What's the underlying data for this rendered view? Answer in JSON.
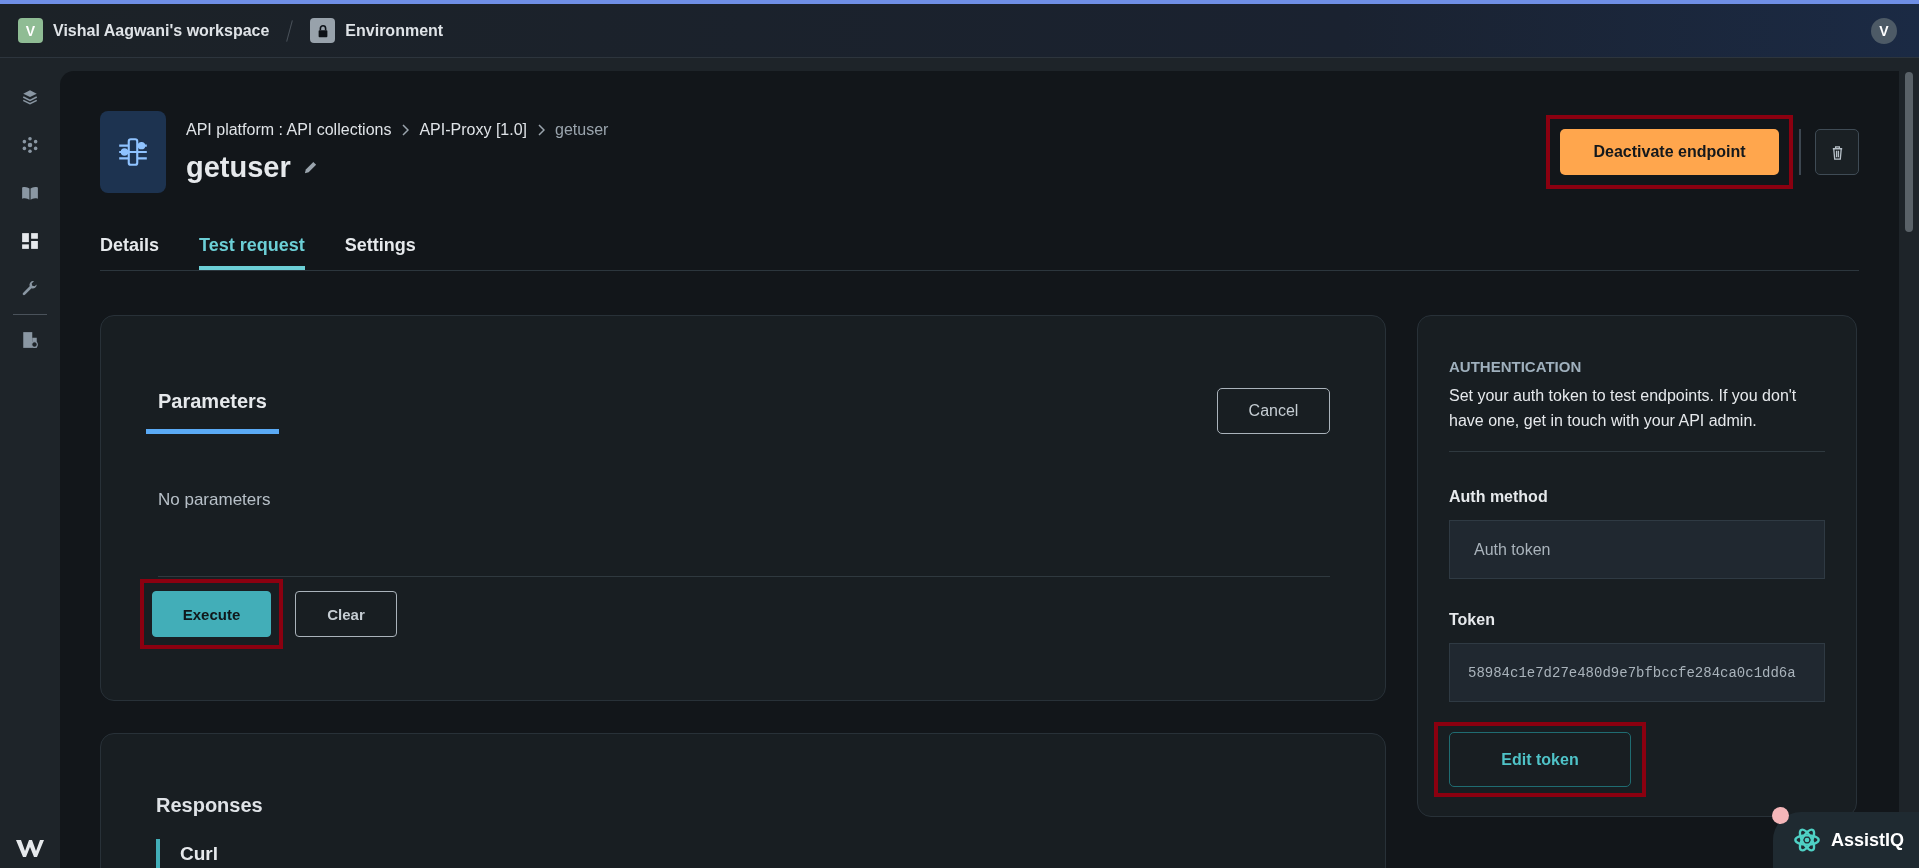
{
  "top_bar": {
    "workspace_initial": "V",
    "workspace": "Vishal Aagwani's workspace",
    "environment": "Environment",
    "user_initial": "V"
  },
  "sidebar": {
    "items": [
      {
        "kind": "layers"
      },
      {
        "kind": "cluster"
      },
      {
        "kind": "book"
      },
      {
        "kind": "grid"
      },
      {
        "kind": "wrench"
      },
      {
        "kind": "divider"
      },
      {
        "kind": "building"
      }
    ]
  },
  "header": {
    "breadcrumb": [
      "API platform : API collections",
      "API-Proxy [1.0]",
      "getuser"
    ],
    "title": "getuser",
    "deactivate_button": {
      "label": "Deactivate endpoint",
      "highlighted": true
    }
  },
  "tabs": [
    {
      "label": "Details",
      "selected": false
    },
    {
      "label": "Test request",
      "selected": true
    },
    {
      "label": "Settings",
      "selected": false
    }
  ],
  "parameters": {
    "tab": "Parameters",
    "cancel": "Cancel",
    "empty": "No parameters",
    "buttons": [
      {
        "kind": "primary",
        "label": "Execute",
        "highlighted": true
      },
      {
        "kind": "outline",
        "label": "Clear",
        "highlighted": false
      }
    ]
  },
  "authentication": {
    "heading": "AUTHENTICATION",
    "description": "Set your auth token to test endpoints. If you don't have one, get in touch with your API admin.",
    "method_label": "Auth method",
    "method_value": "Auth token",
    "token_label": "Token",
    "token_value": "58984c1e7d27e480d9e7bfbccfe284ca0c1dd6a",
    "edit_button": {
      "label": "Edit token",
      "highlighted": true
    }
  },
  "responses": {
    "heading": "Responses",
    "items": [
      {
        "label": "Curl",
        "selected": true
      }
    ]
  },
  "assistant": {
    "label": "AssistIQ",
    "notification": true
  }
}
